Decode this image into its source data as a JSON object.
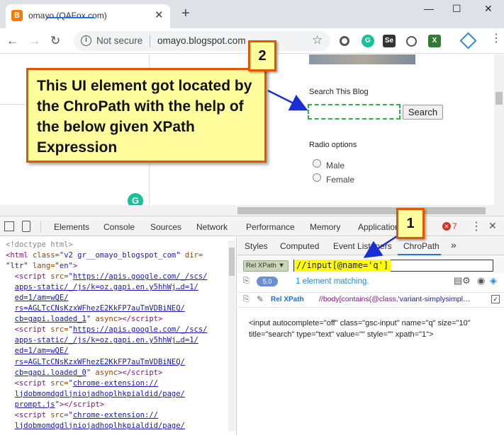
{
  "browser": {
    "tab_title": "omayo (QAFox.com)",
    "tab_favicon": "B",
    "new_tab": "+",
    "window_controls": [
      "—",
      "☐",
      "✕"
    ],
    "security_label": "Not secure",
    "url": "omayo.blogspot.com",
    "extensions": [
      "G",
      "Se",
      "X"
    ]
  },
  "page": {
    "search_label": "Search This Blog",
    "search_button": "Search",
    "radio_label": "Radio options",
    "radio_options": [
      "Male",
      "Female"
    ]
  },
  "devtools": {
    "tabs": [
      "Elements",
      "Console",
      "Sources",
      "Network",
      "Performance",
      "Memory",
      "Application"
    ],
    "error_count": "7",
    "subtabs": [
      "Styles",
      "Computed",
      "Event Listeners",
      "ChroPath"
    ],
    "subtabs_more": "»",
    "dom_lines": {
      "l1": "<!doctype html>",
      "l2_tag": "<html ",
      "l2_attr1": "class=",
      "l2_val1": "\"v2 gr__omayo_blogspot_com\"",
      "l2_attr2": " dir=",
      "l3_val": "\"ltr\"",
      "l3_attr": " lang=",
      "l3_val2": "\"en\"",
      "l3_end": ">",
      "s1_src": "https://apis.google.com/_/scs/",
      "s1_b": "apps-static/_/js/k=oz.gapi.en.y5hhWj…d=1/",
      "s1_c": "ed=1/am=wQE/",
      "s1_d": "rs=AGLTcCNsKzxWFhezE2KkFP7auTmVDBiNEQ/",
      "s1_e": "cb=gapi.loaded_1",
      "s2_src": "https://apis.google.com/_/scs/",
      "s2_b": "apps-static/_/js/k=oz.gapi.en.y5hhWj…d=1/",
      "s2_c": "ed=1/am=wQE/",
      "s2_d": "rs=AGLTcCNsKzxWFhezE2KkFP7auTmVDBiNEQ/",
      "s2_e": "cb=gapi.loaded_0",
      "s3_src": "chrome-extension://",
      "s3_b": "ljdobmomdgdljniojadhoplhkpialdid/page/",
      "s3_c": "prompt.js",
      "s4_src": "chrome-extension://",
      "s4_b": "ljdobmomdgdljniojadhoplhkpialdid/page/"
    },
    "chropath": {
      "mode": "Rel XPath",
      "xpath": "//input[@name='q']",
      "version": "5.0",
      "match_text": "1 element matching.",
      "result_label": "Rel XPath",
      "result_prefix": "//",
      "result_body": "body[contains(@class,",
      "result_tail": "'variant-simplysimpl…",
      "element_html": "<input autocomplete=\"off\" class=\"gsc-input\" name=\"q\" size=\"10\" title=\"search\" type=\"text\" value=\"\" style=\"\" xpath=\"1\">"
    }
  },
  "annotations": {
    "callout_main": "This UI element got located by the ChroPath with the help of the below given XPath Expression",
    "badge_1": "1",
    "badge_2": "2"
  },
  "colors": {
    "callout_fill": "#fffd9c",
    "callout_border": "#e05800",
    "arrow": "#1a2ed6",
    "highlight": "#ffff00"
  }
}
